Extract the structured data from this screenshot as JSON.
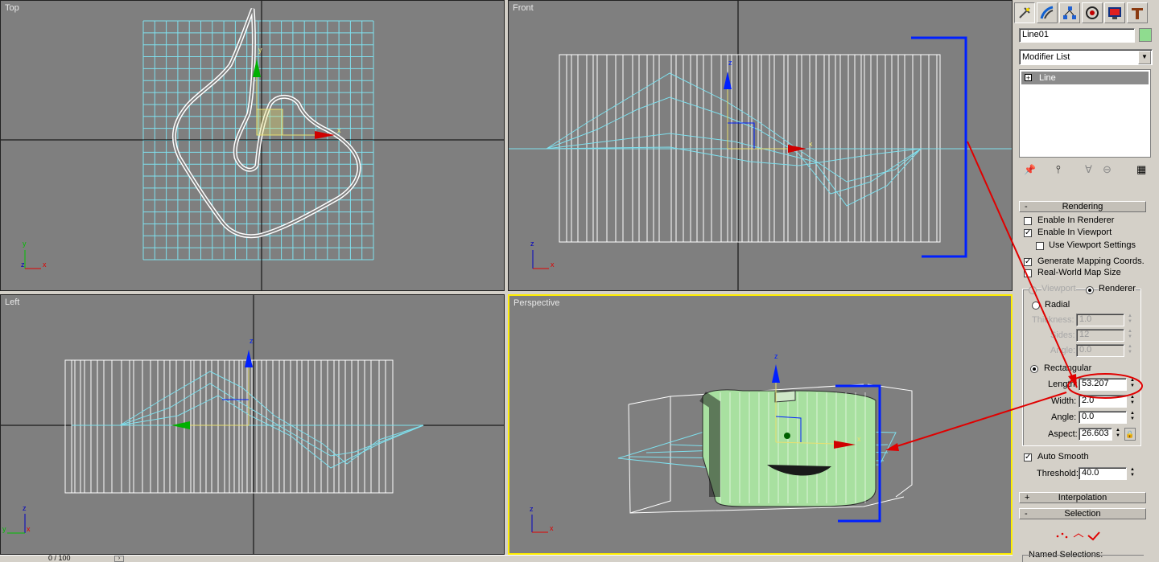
{
  "viewports": {
    "top": {
      "label": "Top"
    },
    "front": {
      "label": "Front"
    },
    "left": {
      "label": "Left"
    },
    "perspective": {
      "label": "Perspective"
    }
  },
  "axis_labels": {
    "x": "x",
    "y": "y",
    "z": "z"
  },
  "command_panel": {
    "tabs": [
      "create-icon",
      "modify-icon",
      "hierarchy-icon",
      "motion-icon",
      "display-icon",
      "utilities-icon"
    ],
    "object_name": "Line01",
    "object_color": "#8fdc8f",
    "modifier_list": "Modifier List",
    "stack": [
      {
        "label": "Line",
        "expand": "+"
      }
    ],
    "stack_tools": [
      "pin-stack-icon",
      "show-end-result-icon",
      "make-unique-icon",
      "remove-modifier-icon",
      "configure-modifier-sets-icon"
    ]
  },
  "rendering": {
    "title": "Rendering",
    "collapse_sign": "-",
    "enable_in_renderer": {
      "label": "Enable In Renderer",
      "checked": false
    },
    "enable_in_viewport": {
      "label": "Enable In Viewport",
      "checked": true
    },
    "use_viewport_settings": {
      "label": "Use Viewport Settings",
      "checked": false
    },
    "generate_mapping": {
      "label": "Generate Mapping Coords.",
      "checked": true
    },
    "real_world_map": {
      "label": "Real-World Map Size",
      "checked": false
    },
    "viewport_radio": "Viewport",
    "renderer_radio": "Renderer",
    "radial": "Radial",
    "thickness": {
      "label": "Thickness:",
      "value": "1.0"
    },
    "sides": {
      "label": "Sides:",
      "value": "12"
    },
    "angle_radial": {
      "label": "Angle:",
      "value": "0.0"
    },
    "rectangular": "Rectangular",
    "length": {
      "label": "Length:",
      "value": "53.207"
    },
    "width": {
      "label": "Width:",
      "value": "2.0"
    },
    "angle": {
      "label": "Angle:",
      "value": "0.0"
    },
    "aspect": {
      "label": "Aspect:",
      "value": "26.603"
    },
    "auto_smooth": {
      "label": "Auto Smooth",
      "checked": true
    },
    "threshold": {
      "label": "Threshold:",
      "value": "40.0"
    }
  },
  "interpolation": {
    "title": "Interpolation",
    "sign": "+"
  },
  "selection": {
    "title": "Selection",
    "sign": "-",
    "named_selections": "Named Selections:"
  },
  "status": {
    "zoom": "0 / 100"
  },
  "colors": {
    "viewport_bg": "#7f7f7f",
    "grid": "#7fe0ee",
    "annotation": "#e00000",
    "gizmo_blue": "#0020ff",
    "active_border": "#ffee00"
  }
}
